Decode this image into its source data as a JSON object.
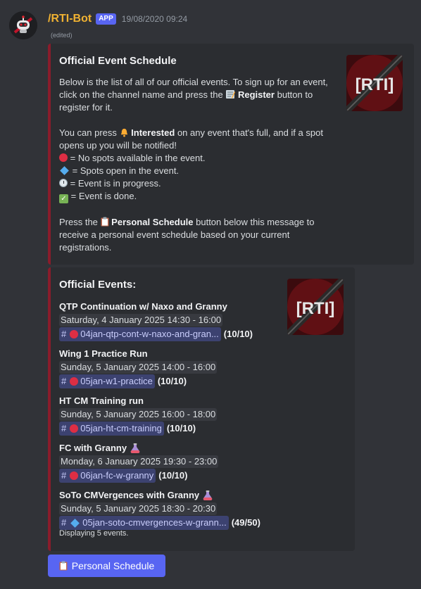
{
  "message": {
    "author": "/RTI-Bot",
    "badge": "APP",
    "timestamp": "19/08/2020 09:24",
    "edited": "(edited)"
  },
  "embed1": {
    "title": "Official Event Schedule",
    "intro_a": "Below is the list of all of our official events. To sign up for an event, click on the channel name and press the",
    "register": "Register",
    "intro_b": "button to register for it.",
    "interested_a": "You can press",
    "interested": "Interested",
    "interested_b": "on any event that's full, and if a spot opens up you will be notified!",
    "legend_full": "= No spots available in the event.",
    "legend_open": "= Spots open in the event.",
    "legend_progress": "= Event is in progress.",
    "legend_done": "= Event is done.",
    "personal_a": "Press the",
    "personal": "Personal Schedule",
    "personal_b": "button below this message to receive a personal event schedule based on your current registrations.",
    "thumb_text": "[RTI]"
  },
  "embed2": {
    "title": "Official Events:",
    "thumb_text": "[RTI]",
    "events": [
      {
        "name": "QTP Continuation w/ Naxo and Granny",
        "date": "Saturday, 4 January 2025 14:30 - 16:00",
        "channel": "04jan-qtp-cont-w-naxo-and-gran...",
        "count": "(10/10)"
      },
      {
        "name": "Wing 1 Practice Run",
        "date": "Sunday, 5 January 2025 14:00 - 16:00",
        "channel": "05jan-w1-practice",
        "count": "(10/10)"
      },
      {
        "name": "HT CM Training run",
        "date": "Sunday, 5 January 2025 16:00 - 18:00",
        "channel": "05jan-ht-cm-training",
        "count": "(10/10)"
      },
      {
        "name": "FC with Granny",
        "date": "Monday, 6 January 2025 19:30 - 23:00",
        "channel": "06jan-fc-w-granny",
        "count": "(10/10)"
      },
      {
        "name": "SoTo CMVergences with Granny",
        "date": "Sunday, 5 January 2025 18:30 - 20:30",
        "channel": "05jan-soto-cmvergences-w-grann...",
        "count": "(49/50)"
      }
    ],
    "footer": "Displaying 5 events."
  },
  "button": {
    "label": "Personal Schedule"
  },
  "colors": {
    "accent": "#5865f2",
    "embed_border": "#8a1c2b",
    "username": "#f0b232"
  }
}
